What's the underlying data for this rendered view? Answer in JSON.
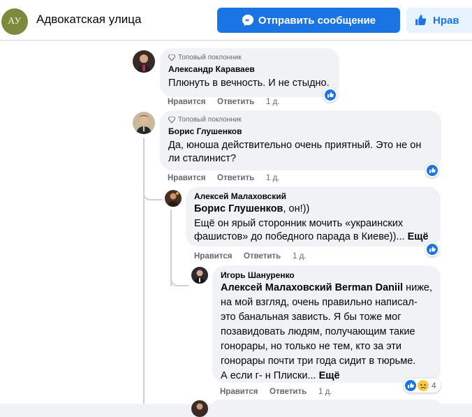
{
  "header": {
    "avatar_text": "АУ",
    "page_name": "Адвокатская улица",
    "message_button": "Отправить сообщение",
    "like_button": "Нрав"
  },
  "comments": [
    {
      "badge": "Топовый поклонник",
      "author": "Александр Караваев",
      "text": "Плюнуть в вечность. И не стыдно.",
      "like": "Нравится",
      "reply": "Ответить",
      "time": "1 д."
    },
    {
      "badge": "Топовый поклонник",
      "author": "Борис Глушенков",
      "line1": "Да, юноша действительно очень приятный. Это не он",
      "line2": "ли сталинист?",
      "like": "Нравится",
      "reply": "Ответить",
      "time": "1 д."
    },
    {
      "author": "Алексей Малаховский",
      "mention": "Борис Глушенков",
      "mention_tail": ", он!))",
      "line2": "Ещё он ярый сторонник мочить «украинских",
      "line3": "фашистов» до победного парада в Киеве))...",
      "more": "Ещё",
      "like": "Нравится",
      "reply": "Ответить",
      "time": "1 д."
    },
    {
      "author": "Игорь Шануренко",
      "mention": "Алексей Малаховский Berman Daniil",
      "mention_tail": " ниже,",
      "lines": [
        "на мой взгляд, очень правильно написал-",
        "это банальная зависть. Я бы тоже мог",
        "позавидовать людям, получающим такие",
        "гонорары, но только не тем, кто за эти",
        "гонорары почти три года сидит в тюрьме.",
        "А если г- н Плиски..."
      ],
      "more": "Ещё",
      "like": "Нравится",
      "reply": "Ответить",
      "time": "1 д.",
      "reaction_count": "4"
    }
  ],
  "colors": {
    "primary": "#1b74e4",
    "bubble": "#f0f2f5",
    "secondary_text": "#65676b"
  }
}
